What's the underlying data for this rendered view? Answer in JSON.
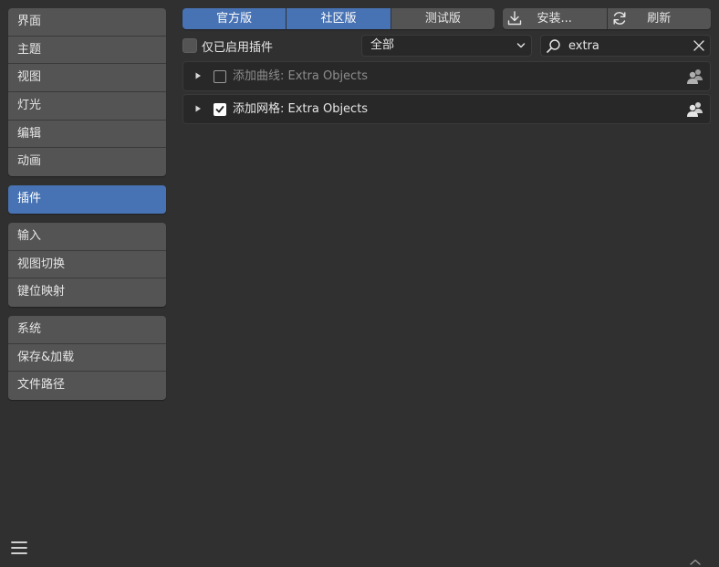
{
  "sidebar": {
    "groups": [
      {
        "items": [
          {
            "label": "界面"
          },
          {
            "label": "主题"
          },
          {
            "label": "视图"
          },
          {
            "label": "灯光"
          },
          {
            "label": "编辑"
          },
          {
            "label": "动画"
          }
        ]
      },
      {
        "items": [
          {
            "label": "插件",
            "active": true
          }
        ]
      },
      {
        "items": [
          {
            "label": "输入"
          },
          {
            "label": "视图切换"
          },
          {
            "label": "键位映射"
          }
        ]
      },
      {
        "items": [
          {
            "label": "系统"
          },
          {
            "label": "保存&加载"
          },
          {
            "label": "文件路径"
          }
        ]
      }
    ]
  },
  "tabs": [
    {
      "label": "官方版",
      "active": true
    },
    {
      "label": "社区版",
      "active": true
    },
    {
      "label": "测试版",
      "active": false
    }
  ],
  "actions": {
    "install": {
      "label": "安装...",
      "icon": "download-icon"
    },
    "refresh": {
      "label": "刷新",
      "icon": "refresh-icon"
    }
  },
  "filters": {
    "enabled_only_label": "仅已启用插件",
    "enabled_only_checked": false,
    "category_value": "全部",
    "search_value": "extra"
  },
  "addons": [
    {
      "name": "添加曲线: Extra Objects",
      "enabled": false,
      "icon": "community-icon"
    },
    {
      "name": "添加网格: Extra Objects",
      "enabled": true,
      "icon": "community-icon"
    }
  ],
  "colors": {
    "background": "#303030",
    "button": "#545454",
    "accent": "#4772b3",
    "field": "#282828",
    "text": "#e6e6e6"
  }
}
